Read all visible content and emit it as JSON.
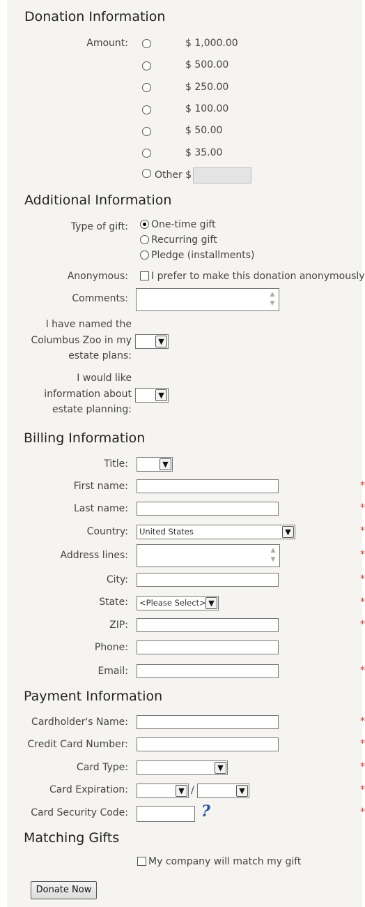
{
  "donation": {
    "heading": "Donation Information",
    "amount_label": "Amount:",
    "amounts": [
      "$ 1,000.00",
      "$ 500.00",
      "$ 250.00",
      "$ 100.00",
      "$ 50.00",
      "$ 35.00"
    ],
    "other_label": "Other $",
    "other_value": ""
  },
  "additional": {
    "heading": "Additional Information",
    "gift_type_label": "Type of gift:",
    "gift_types": [
      "One-time gift",
      "Recurring gift",
      "Pledge (installments)"
    ],
    "gift_type_selected": "One-time gift",
    "anonymous_label": "Anonymous:",
    "anonymous_text": "I prefer to make this donation anonymously",
    "comments_label": "Comments:",
    "estate_named_label": [
      "I have named the",
      "Columbus Zoo in my",
      "estate plans:"
    ],
    "estate_info_label": [
      "I would like",
      "information about",
      "estate planning:"
    ]
  },
  "billing": {
    "heading": "Billing Information",
    "title_label": "Title:",
    "first_name_label": "First name:",
    "last_name_label": "Last name:",
    "country_label": "Country:",
    "country_value": "United States",
    "address_label": "Address lines:",
    "city_label": "City:",
    "state_label": "State:",
    "state_value": "<Please Select>",
    "zip_label": "ZIP:",
    "phone_label": "Phone:",
    "email_label": "Email:"
  },
  "payment": {
    "heading": "Payment Information",
    "cardholder_label": "Cardholder's Name:",
    "card_number_label": "Credit Card Number:",
    "card_type_label": "Card Type:",
    "expiration_label": "Card Expiration:",
    "expiration_separator": "/",
    "security_label": "Card Security Code:"
  },
  "matching": {
    "heading": "Matching Gifts",
    "checkbox_text": "My company will match my gift"
  },
  "submit_label": "Donate Now",
  "required_marker": "*",
  "icons": {
    "help": "question-mark-icon",
    "dropdown": "chevron-down-icon"
  },
  "colors": {
    "required": "#e23a2a",
    "panel_bg": "#f5f4f0",
    "help_icon": "#2a55a5"
  }
}
